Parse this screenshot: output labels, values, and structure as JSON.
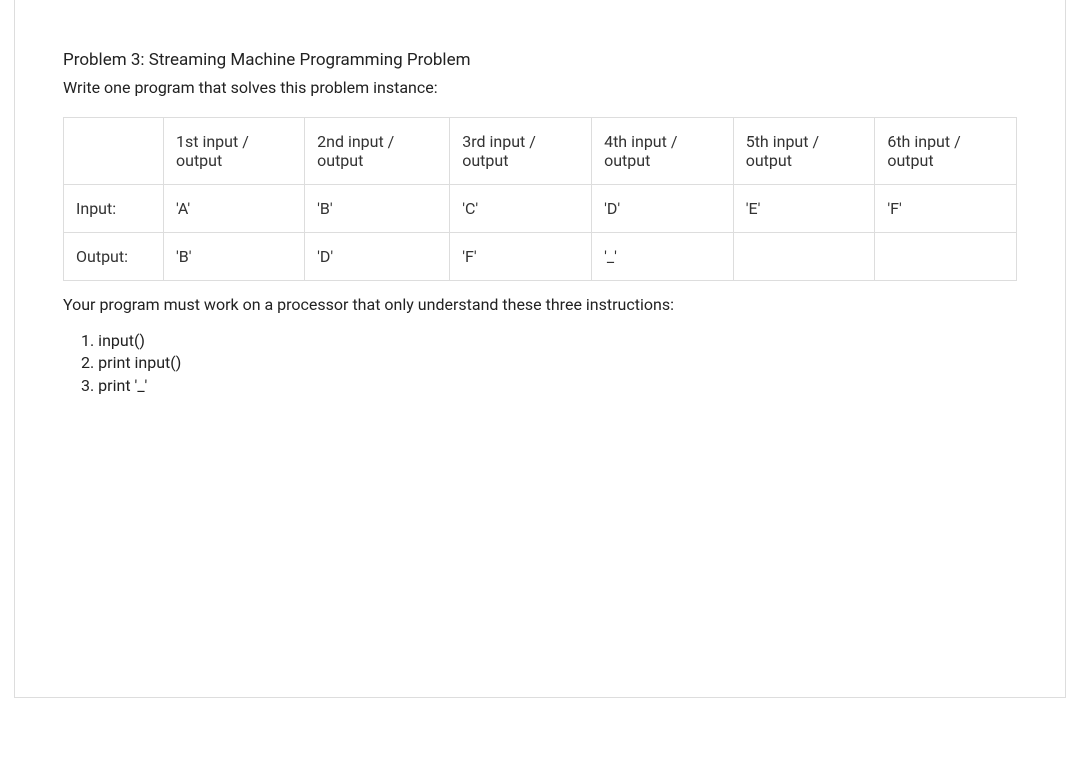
{
  "problem": {
    "title": "Problem 3: Streaming Machine Programming Problem",
    "instruction": "Write one program that solves this problem instance:"
  },
  "table": {
    "headers": {
      "blank": "",
      "col1": "1st input / output",
      "col2": "2nd input / output",
      "col3": "3rd input / output",
      "col4": "4th input / output",
      "col5": "5th input / output",
      "col6": "6th input / output"
    },
    "rows": {
      "input": {
        "label": "Input:",
        "c1": "'A'",
        "c2": "'B'",
        "c3": "'C'",
        "c4": "'D'",
        "c5": "'E'",
        "c6": "'F'"
      },
      "output": {
        "label": "Output:",
        "c1": "'B'",
        "c2": "'D'",
        "c3": "'F'",
        "c4": "'_'",
        "c5": "",
        "c6": ""
      }
    }
  },
  "afterTable": "Your program must work on a processor that only understand these three instructions:",
  "instructions": {
    "i1": "1. input()",
    "i2": "2. print input()",
    "i3": "3. print '_'"
  }
}
